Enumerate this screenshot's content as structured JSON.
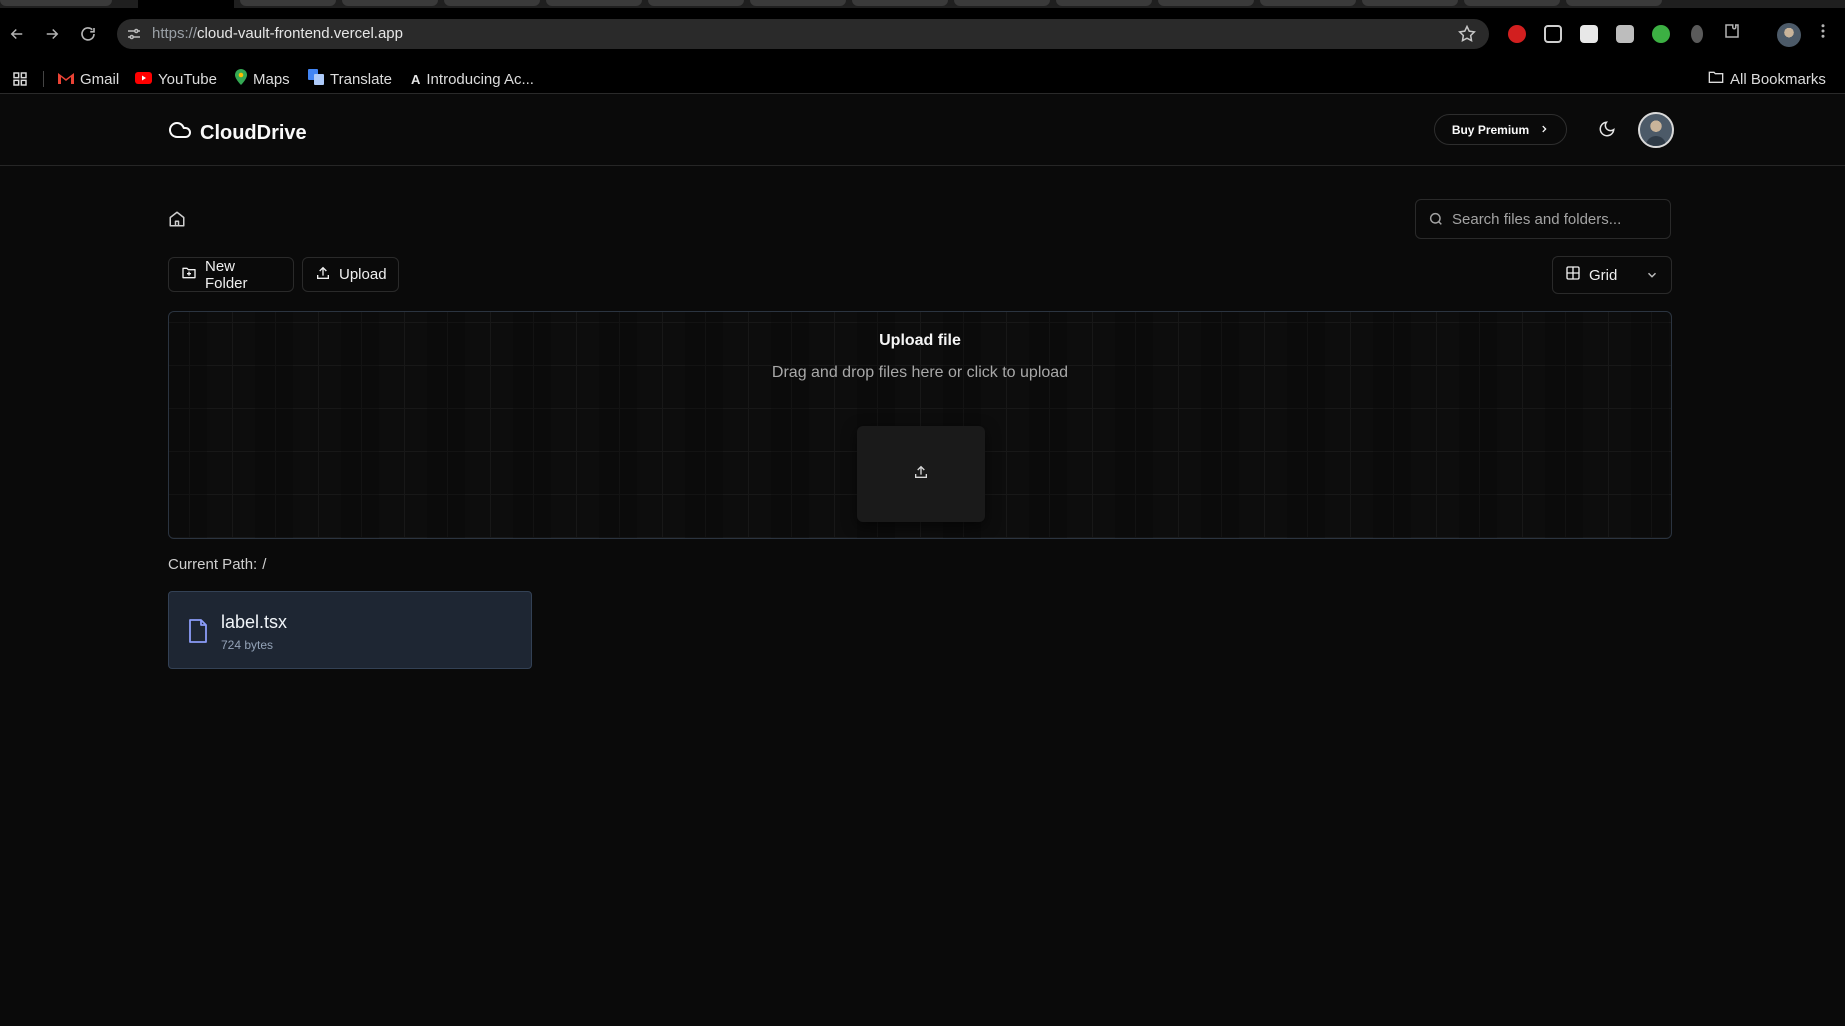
{
  "browser": {
    "url_scheme": "https://",
    "url_host": "cloud-vault-frontend.vercel.app",
    "bookmarks": [
      {
        "label": "Gmail",
        "icon": "gmail-icon"
      },
      {
        "label": "YouTube",
        "icon": "youtube-icon"
      },
      {
        "label": "Maps",
        "icon": "maps-icon"
      },
      {
        "label": "Translate",
        "icon": "translate-icon"
      },
      {
        "label": "Introducing Ac...",
        "icon": "anthropic-icon"
      }
    ],
    "all_bookmarks_label": "All Bookmarks"
  },
  "header": {
    "brand": "CloudDrive",
    "brand_icon": "cloud-icon",
    "premium_label": "Buy Premium",
    "theme_icon": "moon-icon"
  },
  "toolbar": {
    "search_placeholder": "Search files and folders...",
    "new_folder_label": "New Folder",
    "upload_label": "Upload",
    "view_label": "Grid"
  },
  "dropzone": {
    "title": "Upload file",
    "subtitle": "Drag and drop files here or click to upload"
  },
  "path": {
    "label": "Current Path:",
    "value": "/"
  },
  "files": [
    {
      "name": "label.tsx",
      "size": "724 bytes",
      "icon": "file-icon"
    }
  ],
  "colors": {
    "background": "#0a0a0a",
    "card": "#1e2633",
    "card_border": "#334155",
    "file_icon": "#8b9cf8"
  }
}
